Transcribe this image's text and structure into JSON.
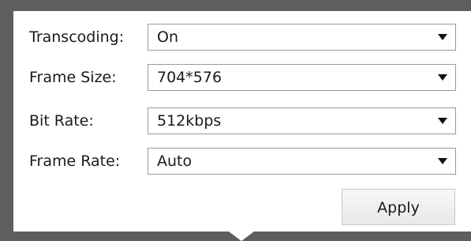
{
  "form": {
    "fields": [
      {
        "label": "Transcoding:",
        "value": "On"
      },
      {
        "label": "Frame Size:",
        "value": "704*576"
      },
      {
        "label": "Bit Rate:",
        "value": "512kbps"
      },
      {
        "label": "Frame Rate:",
        "value": "Auto"
      }
    ],
    "apply_label": "Apply"
  },
  "icons": {
    "dropdown": "caret-down-icon"
  }
}
